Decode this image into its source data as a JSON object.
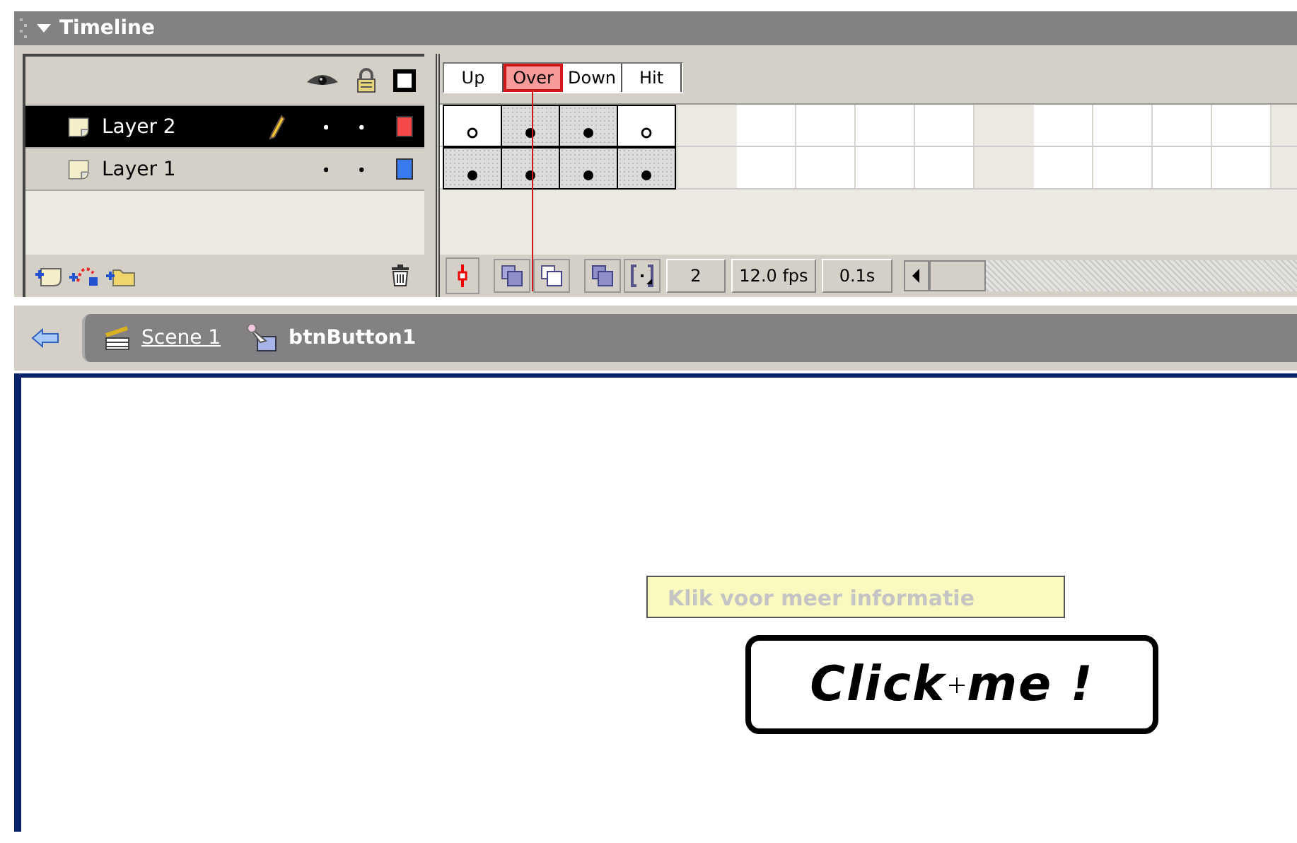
{
  "panel": {
    "title": "Timeline",
    "expanded": true
  },
  "frame_labels": [
    {
      "label": "Up",
      "selected": false
    },
    {
      "label": "Over",
      "selected": true
    },
    {
      "label": "Down",
      "selected": false
    },
    {
      "label": "Hit",
      "selected": false
    }
  ],
  "layers": [
    {
      "name": "Layer 2",
      "selected": true,
      "editing": true,
      "color": "#f24a4a",
      "frames": [
        {
          "kind": "empty"
        },
        {
          "kind": "filled"
        },
        {
          "kind": "filled"
        },
        {
          "kind": "empty"
        }
      ]
    },
    {
      "name": "Layer 1",
      "selected": false,
      "editing": false,
      "color": "#3a7af0",
      "frames": [
        {
          "kind": "filled"
        },
        {
          "kind": "filled"
        },
        {
          "kind": "filled"
        },
        {
          "kind": "filled"
        }
      ]
    }
  ],
  "status": {
    "current_frame": "2",
    "frame_rate": "12.0 fps",
    "elapsed": "0.1s"
  },
  "breadcrumb": {
    "scene": "Scene 1",
    "symbol": "btnButton1"
  },
  "stage": {
    "tooltip": "Klik voor meer informatie",
    "button_words": [
      "Click",
      "me !"
    ]
  }
}
